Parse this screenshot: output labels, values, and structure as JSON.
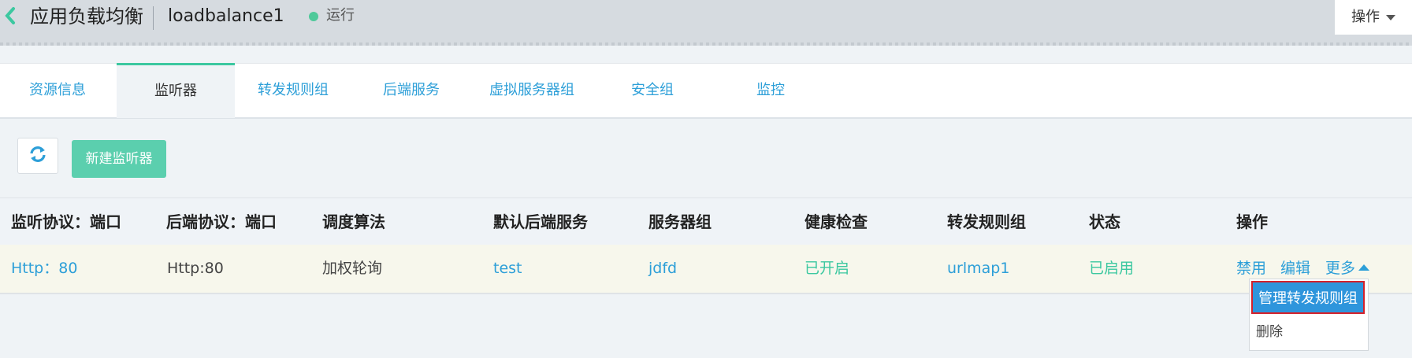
{
  "header": {
    "title": "应用负载均衡",
    "instance_name": "loadbalance1",
    "status": "运行",
    "ops_label": "操作",
    "colors": {
      "status": "#4fc99a",
      "accent": "#3cc8a0"
    }
  },
  "tabs": [
    {
      "label": "资源信息",
      "active": false
    },
    {
      "label": "监听器",
      "active": true
    },
    {
      "label": "转发规则组",
      "active": false
    },
    {
      "label": "后端服务",
      "active": false
    },
    {
      "label": "虚拟服务器组",
      "active": false
    },
    {
      "label": "安全组",
      "active": false
    },
    {
      "label": "监控",
      "active": false
    }
  ],
  "toolbar": {
    "refresh_icon": "refresh-icon",
    "new_listener_label": "新建监听器"
  },
  "table": {
    "columns": [
      "监听协议：端口",
      "后端协议：端口",
      "调度算法",
      "默认后端服务",
      "服务器组",
      "健康检查",
      "转发规则组",
      "状态",
      "操作"
    ],
    "rows": [
      {
        "listen": "Http：80",
        "backend": "Http:80",
        "algorithm": "加权轮询",
        "default_backend": "test",
        "server_group": "jdfd",
        "health_check": "已开启",
        "rule_group": "urlmap1",
        "status": "已启用",
        "actions": {
          "disable": "禁用",
          "edit": "编辑",
          "more": "更多"
        }
      }
    ]
  },
  "dropdown": {
    "items": [
      "管理转发规则组",
      "删除"
    ],
    "highlight_color": "#2e95dc"
  }
}
